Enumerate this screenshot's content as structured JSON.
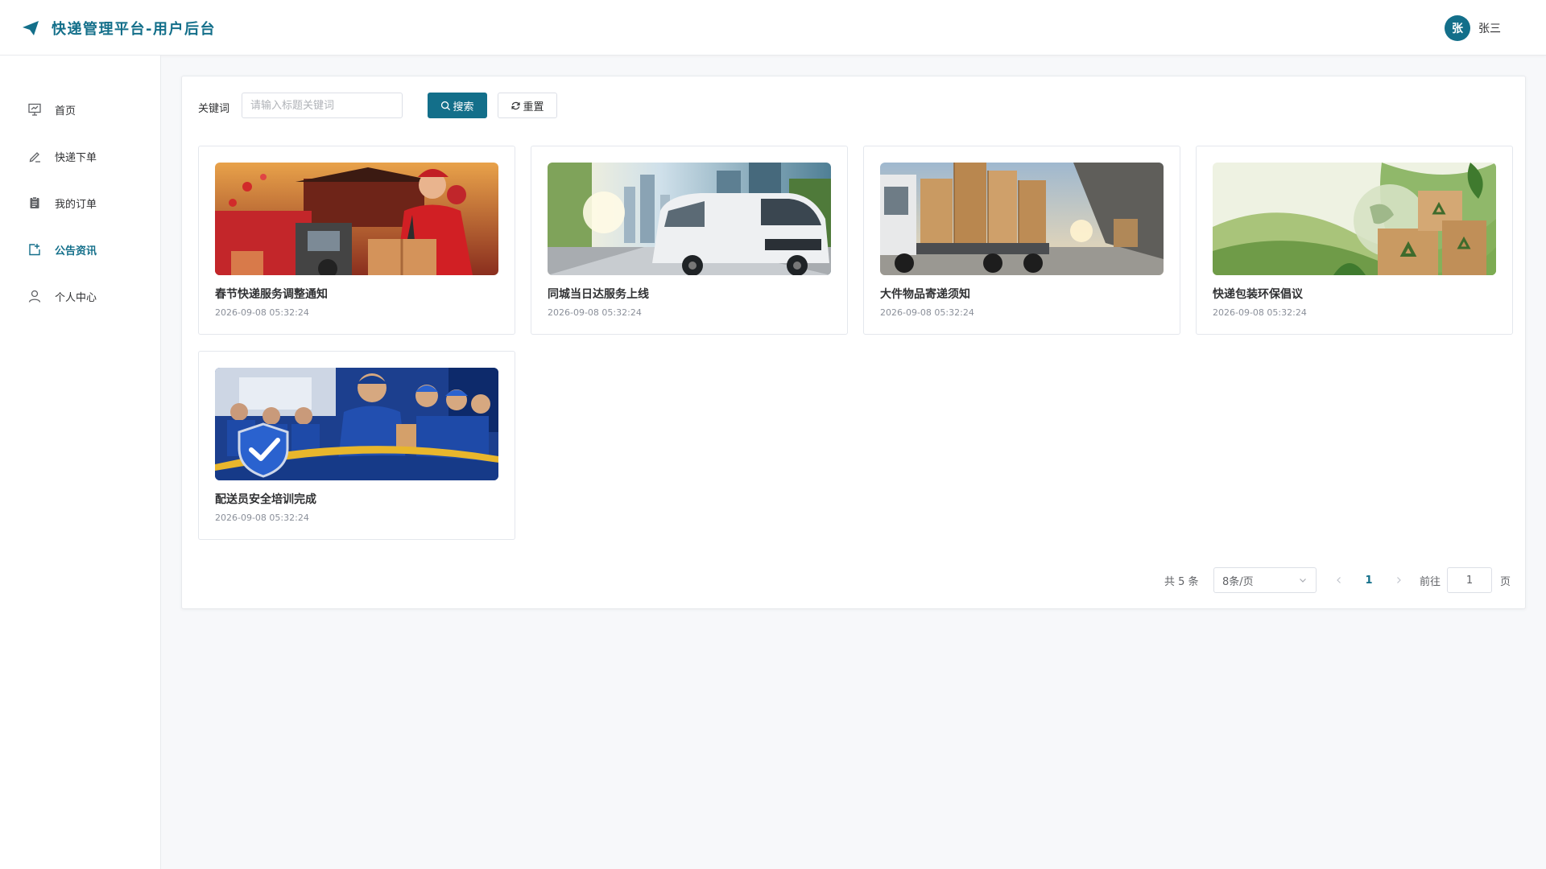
{
  "header": {
    "title": "快递管理平台-用户后台",
    "avatar_text": "张",
    "user_name": "张三"
  },
  "sidebar": {
    "items": [
      {
        "label": "首页",
        "icon": "presentation-board-icon",
        "active": false
      },
      {
        "label": "快递下单",
        "icon": "pen-icon",
        "active": false
      },
      {
        "label": "我的订单",
        "icon": "clipboard-icon",
        "active": false
      },
      {
        "label": "公告资讯",
        "icon": "notice-icon",
        "active": true
      },
      {
        "label": "个人中心",
        "icon": "user-icon",
        "active": false
      }
    ]
  },
  "filter": {
    "keyword_label": "关键词",
    "keyword_placeholder": "请输入标题关键词",
    "keyword_value": "",
    "search_label": "搜索",
    "reset_label": "重置"
  },
  "cards": [
    {
      "title": "春节快递服务调整通知",
      "date": "2026-09-08 05:32:24"
    },
    {
      "title": "同城当日达服务上线",
      "date": "2026-09-08 05:32:24"
    },
    {
      "title": "大件物品寄递须知",
      "date": "2026-09-08 05:32:24"
    },
    {
      "title": "快递包装环保倡议",
      "date": "2026-09-08 05:32:24"
    },
    {
      "title": "配送员安全培训完成",
      "date": "2026-09-08 05:32:24"
    }
  ],
  "pagination": {
    "total_text": "共 5 条",
    "page_size": "8条/页",
    "current_page": "1",
    "goto_label": "前往",
    "goto_value": "1",
    "page_unit": "页"
  },
  "colors": {
    "accent": "#136f8a",
    "background": "#f7f8fa",
    "card_border": "#e4e7ed"
  }
}
